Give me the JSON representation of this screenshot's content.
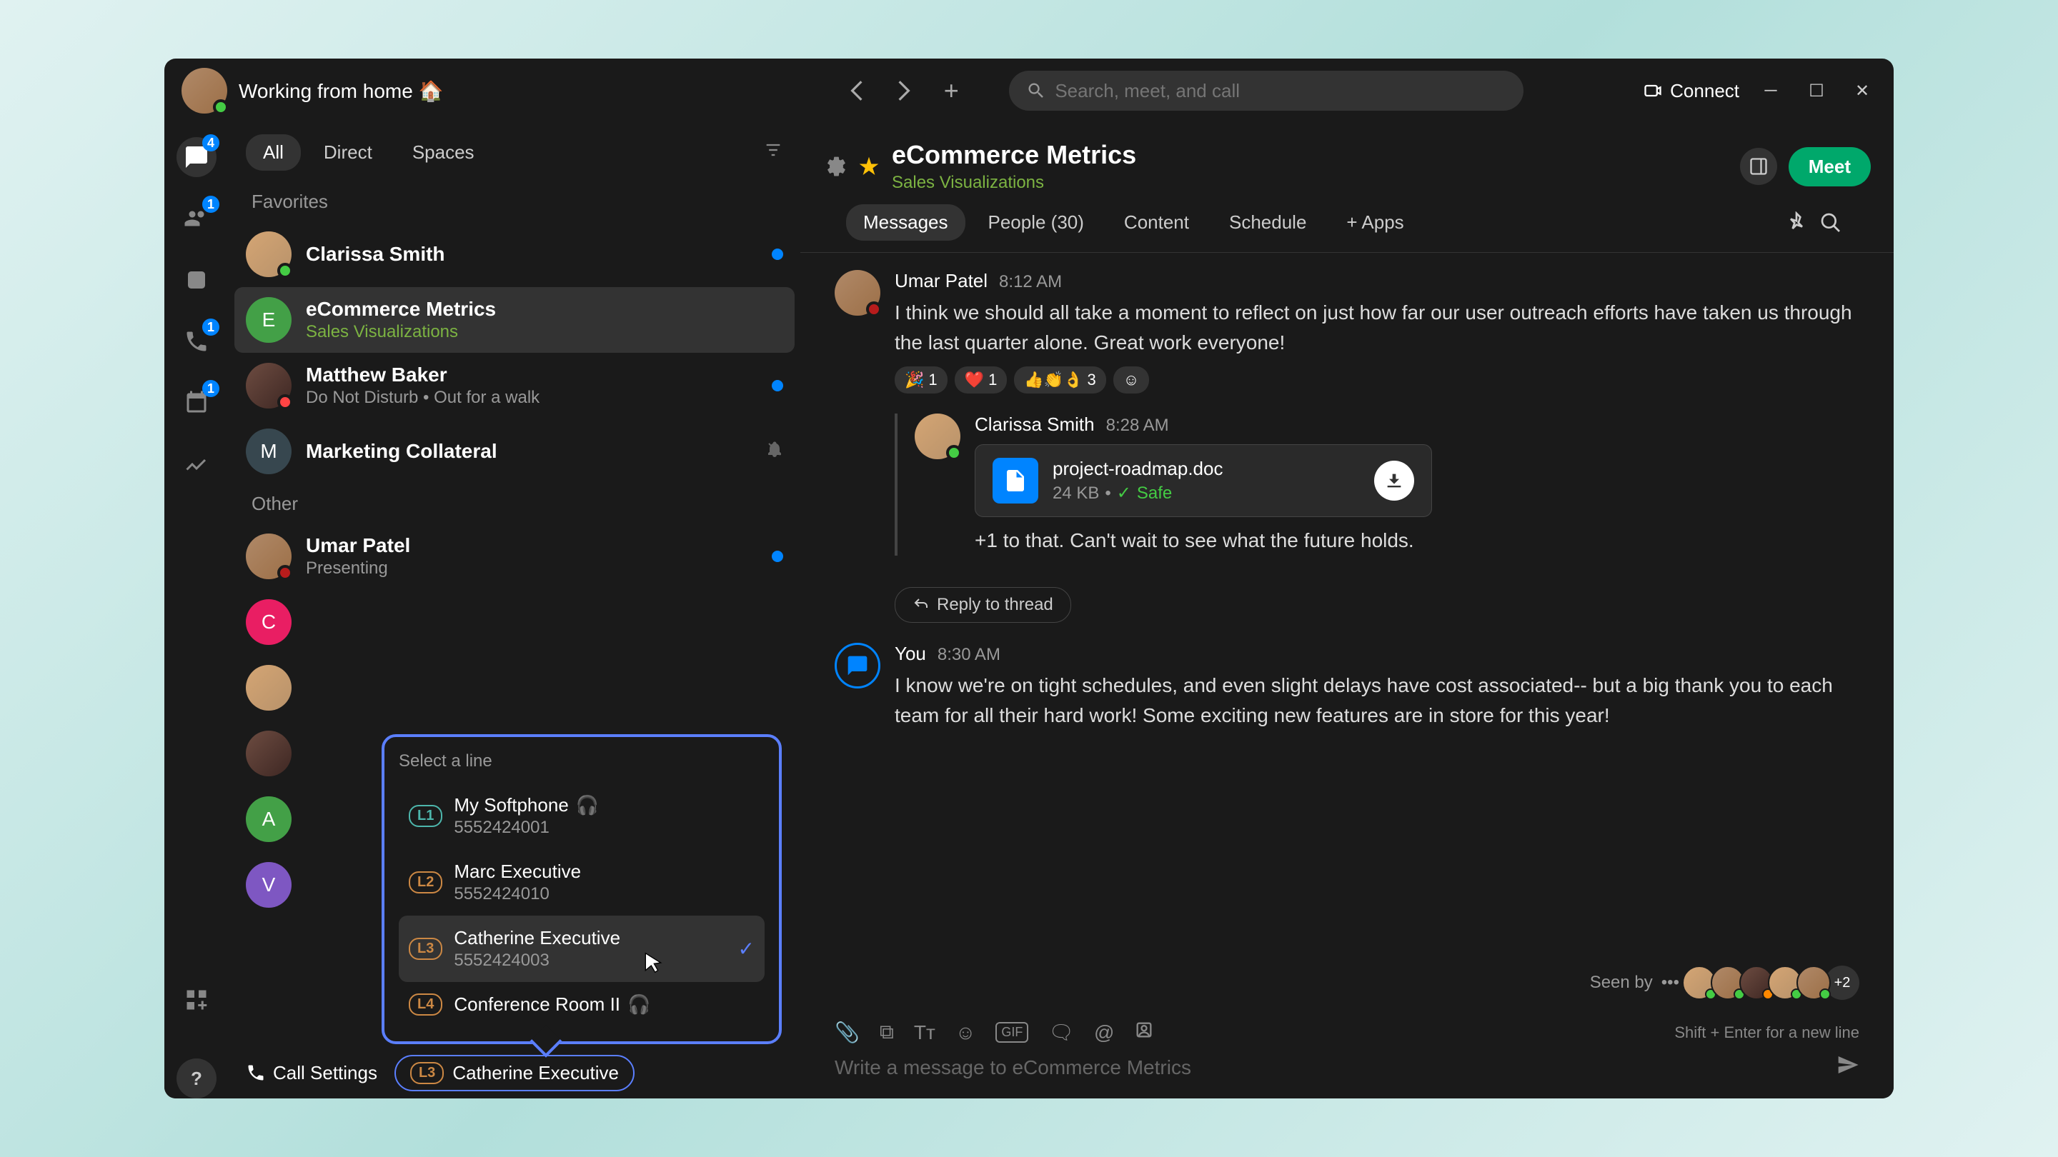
{
  "titleBar": {
    "status": "Working from home 🏠",
    "searchPlaceholder": "Search, meet, and call",
    "connect": "Connect"
  },
  "leftRail": {
    "chatBadge": "4",
    "contactsBadge": "1",
    "callBadge": "1",
    "calendarBadge": "1"
  },
  "sidebar": {
    "tabs": {
      "all": "All",
      "direct": "Direct",
      "spaces": "Spaces"
    },
    "sections": {
      "favorites": "Favorites",
      "other": "Other"
    },
    "items": [
      {
        "name": "Clarissa Smith",
        "sub": "",
        "initial": ""
      },
      {
        "name": "eCommerce Metrics",
        "sub": "Sales Visualizations",
        "initial": "E"
      },
      {
        "name": "Matthew Baker",
        "sub": "Do Not Disturb  •  Out for a walk",
        "initial": ""
      },
      {
        "name": "Marketing Collateral",
        "sub": "",
        "initial": "M"
      },
      {
        "name": "Umar Patel",
        "sub": "Presenting",
        "initial": ""
      }
    ],
    "hiddenInitials": [
      "C",
      "",
      "",
      "A",
      "V"
    ]
  },
  "chat": {
    "title": "eCommerce Metrics",
    "subtitle": "Sales Visualizations",
    "meetBtn": "Meet",
    "tabs": {
      "messages": "Messages",
      "people": "People (30)",
      "content": "Content",
      "schedule": "Schedule",
      "apps": "+   Apps"
    },
    "messages": [
      {
        "author": "Umar Patel",
        "time": "8:12 AM",
        "text": "I think we should all take a moment to reflect on just how far our user outreach efforts have taken us through the last quarter alone. Great work everyone!",
        "reactions": [
          {
            "emoji": "🎉",
            "count": "1"
          },
          {
            "emoji": "❤️",
            "count": "1"
          },
          {
            "emoji": "👍👏👌",
            "count": "3"
          }
        ]
      },
      {
        "author": "Clarissa Smith",
        "time": "8:28 AM",
        "file": {
          "name": "project-roadmap.doc",
          "size": "24 KB",
          "safe": "Safe"
        },
        "text": "+1 to that. Can't wait to see what the future holds."
      },
      {
        "author": "You",
        "time": "8:30 AM",
        "text": "I know we're on tight schedules, and even slight delays have cost associated-- but a big thank you to each team for all their hard work! Some exciting new features are in store for this year!"
      }
    ],
    "replyThread": "Reply to thread",
    "seenBy": "Seen by",
    "seenMore": "+2",
    "composerPlaceholder": "Write a message to eCommerce Metrics",
    "composerHint": "Shift + Enter for a new line"
  },
  "bottomBar": {
    "callSettings": "Call Settings",
    "activeLine": {
      "badge": "L3",
      "name": "Catherine Executive"
    }
  },
  "linePopup": {
    "title": "Select a line",
    "lines": [
      {
        "badge": "L1",
        "name": "My Softphone",
        "number": "5552424001",
        "icon": true
      },
      {
        "badge": "L2",
        "name": "Marc Executive",
        "number": "5552424010"
      },
      {
        "badge": "L3",
        "name": "Catherine Executive",
        "number": "5552424003",
        "selected": true
      },
      {
        "badge": "L4",
        "name": "Conference Room II",
        "number": "",
        "icon": true
      }
    ]
  }
}
